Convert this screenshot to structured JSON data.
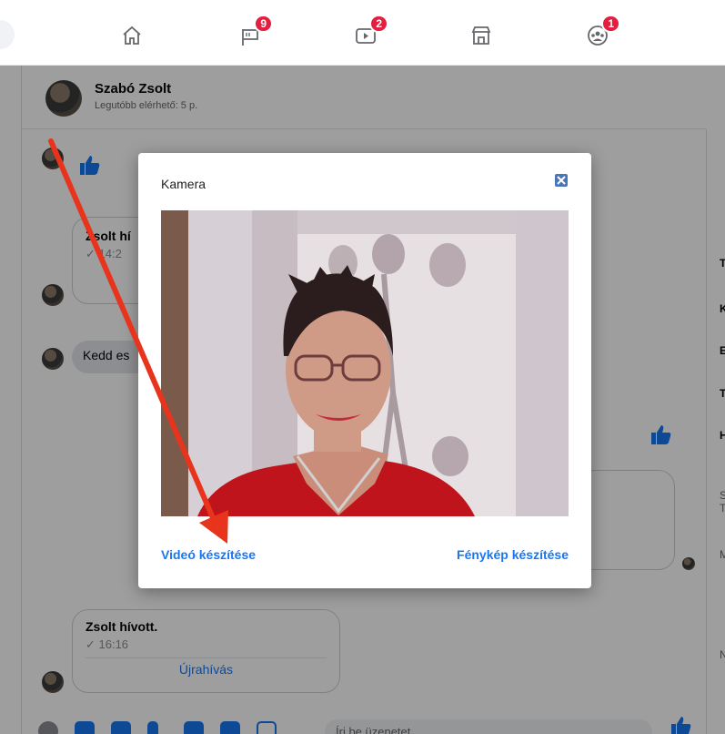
{
  "topnav": {
    "items": [
      {
        "icon": "home-icon",
        "badge": ""
      },
      {
        "icon": "flag-icon",
        "badge": "9"
      },
      {
        "icon": "watch-icon",
        "badge": "2"
      },
      {
        "icon": "marketplace-icon",
        "badge": ""
      },
      {
        "icon": "groups-icon",
        "badge": "1"
      }
    ]
  },
  "chat": {
    "contact_name": "Szabó Zsolt",
    "contact_status": "Legutóbb elérhető: 5 p.",
    "call1": {
      "title": "Zsolt hí",
      "time": "✓ 14:2"
    },
    "msg_partial": "Kedd es",
    "call2": {
      "title": "Zsolt hívott.",
      "time": "✓ 16:16",
      "action": "Újrahívás"
    },
    "composer_placeholder": "Írj be üzenetet..."
  },
  "rightpanel": {
    "letters": [
      "T",
      "K",
      "E",
      "T",
      "H",
      "S",
      "T",
      "M",
      "N"
    ]
  },
  "modal": {
    "title": "Kamera",
    "close": "×",
    "video_button": "Videó készítése",
    "photo_button": "Fénykép készítése"
  },
  "colors": {
    "accent": "#1877f2",
    "badge": "#e41e3f",
    "arrow": "#e8341c"
  }
}
